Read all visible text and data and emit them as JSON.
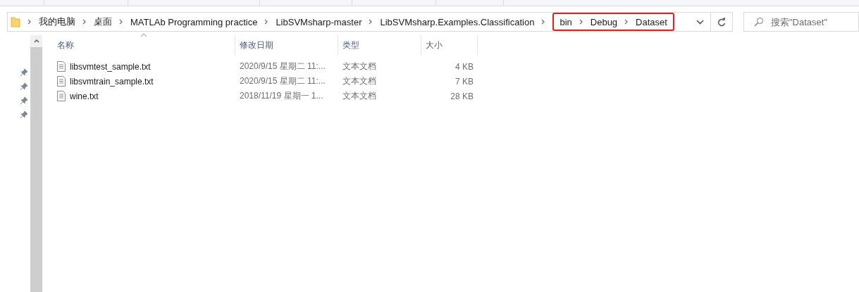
{
  "breadcrumb": [
    "我的电脑",
    "桌面",
    "MATLAb Programming practice",
    "LibSVMsharp-master",
    "LibSVMsharp.Examples.Classification"
  ],
  "highlighted_breadcrumb": [
    "bin",
    "Debug",
    "Dataset"
  ],
  "search": {
    "placeholder": "搜索\"Dataset\""
  },
  "columns": [
    {
      "label": "名称",
      "sorted": true
    },
    {
      "label": "修改日期",
      "sorted": false
    },
    {
      "label": "类型",
      "sorted": false
    },
    {
      "label": "大小",
      "sorted": false
    }
  ],
  "files": [
    {
      "name": "libsvmtest_sample.txt",
      "date": "2020/9/15 星期二 11:...",
      "type": "文本文档",
      "size": "4 KB"
    },
    {
      "name": "libsvmtrain_sample.txt",
      "date": "2020/9/15 星期二 11:...",
      "type": "文本文档",
      "size": "7 KB"
    },
    {
      "name": "wine.txt",
      "date": "2018/11/19 星期一 1...",
      "type": "文本文档",
      "size": "28 KB"
    }
  ]
}
